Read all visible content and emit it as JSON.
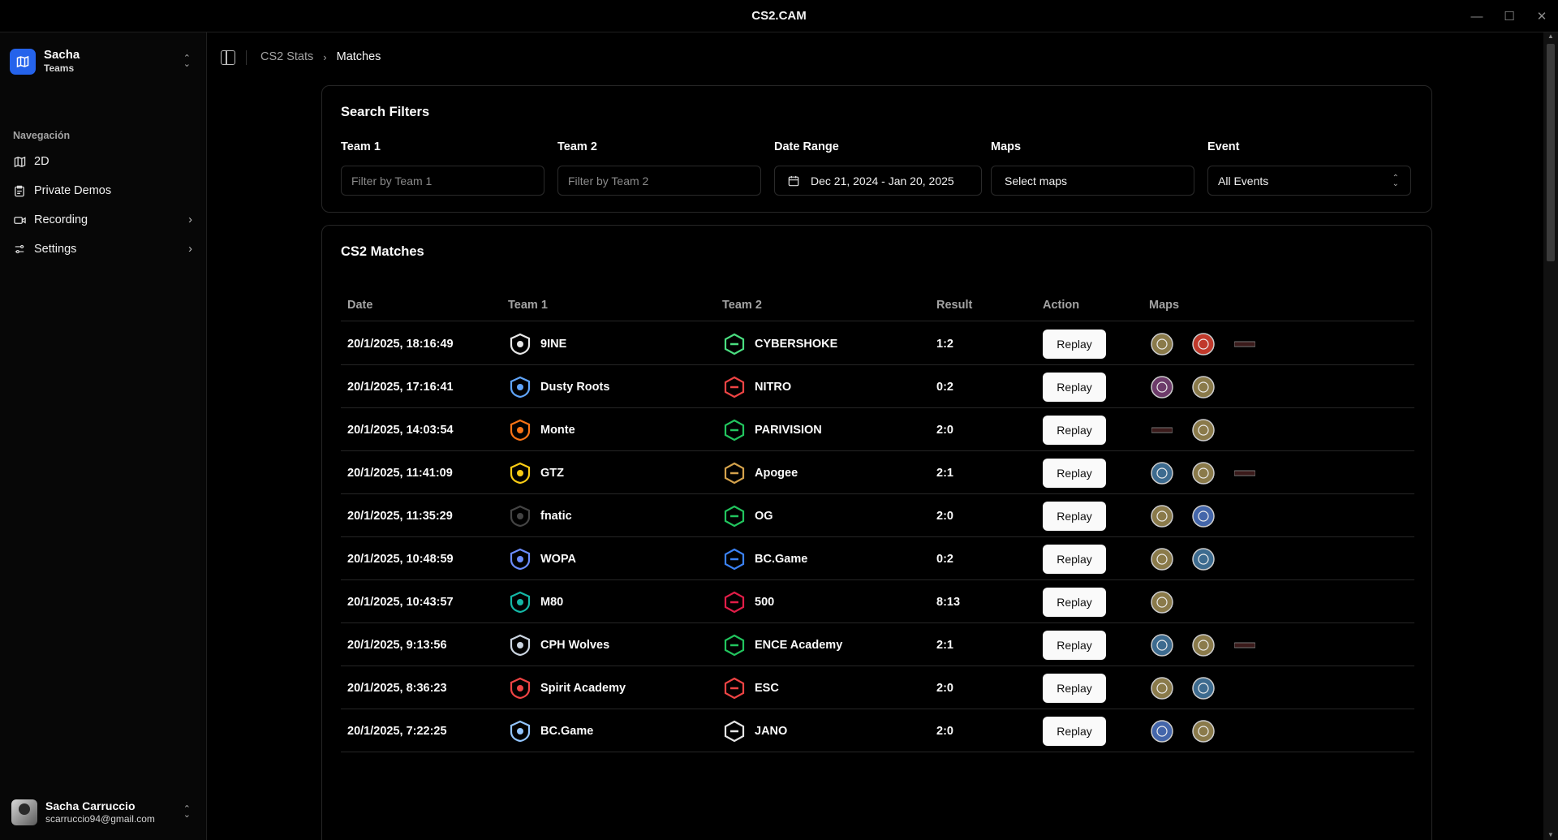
{
  "window": {
    "title": "CS2.CAM"
  },
  "sidebar": {
    "team": {
      "name": "Sacha",
      "subtitle": "Teams"
    },
    "nav_heading": "Navegación",
    "items": [
      {
        "label": "2D",
        "icon": "map-icon",
        "has_chevron": false
      },
      {
        "label": "Private Demos",
        "icon": "clipboard-icon",
        "has_chevron": false
      },
      {
        "label": "Recording",
        "icon": "video-icon",
        "has_chevron": true
      },
      {
        "label": "Settings",
        "icon": "sliders-icon",
        "has_chevron": true
      }
    ],
    "user": {
      "name": "Sacha Carruccio",
      "email": "scarruccio94@gmail.com"
    }
  },
  "breadcrumb": {
    "root": "CS2 Stats",
    "current": "Matches"
  },
  "filters": {
    "title": "Search Filters",
    "team1": {
      "label": "Team 1",
      "placeholder": "Filter by Team 1"
    },
    "team2": {
      "label": "Team 2",
      "placeholder": "Filter by Team 2"
    },
    "date_range": {
      "label": "Date Range",
      "value": "Dec 21, 2024 - Jan 20, 2025"
    },
    "maps": {
      "label": "Maps",
      "value": "Select maps"
    },
    "event": {
      "label": "Event",
      "value": "All Events"
    }
  },
  "matches": {
    "title": "CS2 Matches",
    "columns": [
      "Date",
      "Team 1",
      "Team 2",
      "Result",
      "Action",
      "Maps"
    ],
    "action_label": "Replay",
    "rows": [
      {
        "date": "20/1/2025, 18:16:49",
        "team1": "9INE",
        "team2": "CYBERSHOKE",
        "result": "1:2",
        "maps": [
          "ancient",
          "anubis",
          "nuke"
        ]
      },
      {
        "date": "20/1/2025, 17:16:41",
        "team1": "Dusty Roots",
        "team2": "NITRO",
        "result": "0:2",
        "maps": [
          "dust2",
          "ancient"
        ]
      },
      {
        "date": "20/1/2025, 14:03:54",
        "team1": "Monte",
        "team2": "PARIVISION",
        "result": "2:0",
        "maps": [
          "nuke",
          "ancient"
        ]
      },
      {
        "date": "20/1/2025, 11:41:09",
        "team1": "GTZ",
        "team2": "Apogee",
        "result": "2:1",
        "maps": [
          "mirage",
          "ancient",
          "nuke"
        ]
      },
      {
        "date": "20/1/2025, 11:35:29",
        "team1": "fnatic",
        "team2": "OG",
        "result": "2:0",
        "maps": [
          "ancient",
          "inferno"
        ]
      },
      {
        "date": "20/1/2025, 10:48:59",
        "team1": "WOPA",
        "team2": "BC.Game",
        "result": "0:2",
        "maps": [
          "ancient",
          "mirage"
        ]
      },
      {
        "date": "20/1/2025, 10:43:57",
        "team1": "M80",
        "team2": "500",
        "result": "8:13",
        "maps": [
          "ancient"
        ]
      },
      {
        "date": "20/1/2025, 9:13:56",
        "team1": "CPH Wolves",
        "team2": "ENCE Academy",
        "result": "2:1",
        "maps": [
          "mirage",
          "ancient",
          "nuke"
        ]
      },
      {
        "date": "20/1/2025, 8:36:23",
        "team1": "Spirit Academy",
        "team2": "ESC",
        "result": "2:0",
        "maps": [
          "ancient",
          "mirage"
        ]
      },
      {
        "date": "20/1/2025, 7:22:25",
        "team1": "BC.Game",
        "team2": "JANO",
        "result": "2:0",
        "maps": [
          "inferno",
          "ancient"
        ]
      }
    ]
  }
}
